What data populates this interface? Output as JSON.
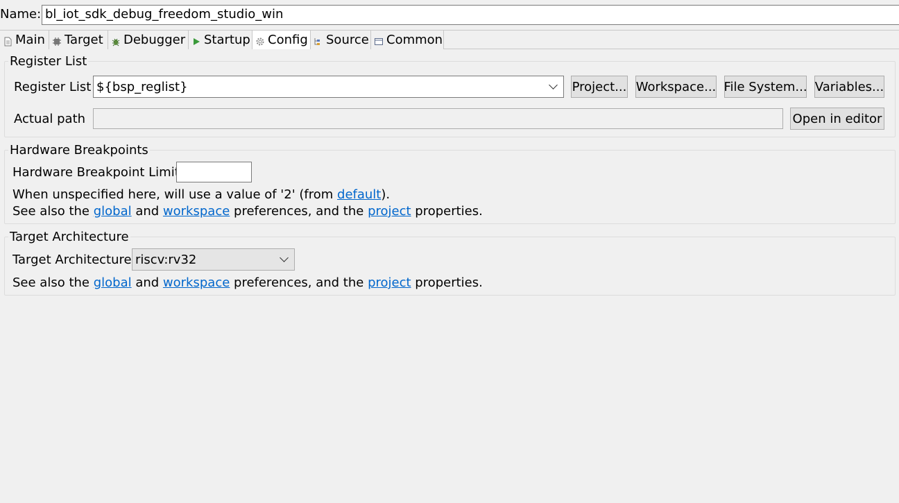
{
  "name": {
    "label": "Name:",
    "value": "bl_iot_sdk_debug_freedom_studio_win"
  },
  "tabs": [
    {
      "label": "Main",
      "icon": "document-icon"
    },
    {
      "label": "Target",
      "icon": "chip-icon"
    },
    {
      "label": "Debugger",
      "icon": "bug-icon"
    },
    {
      "label": "Startup",
      "icon": "play-icon"
    },
    {
      "label": "Config",
      "icon": "gear-icon"
    },
    {
      "label": "Source",
      "icon": "source-icon"
    },
    {
      "label": "Common",
      "icon": "window-icon"
    }
  ],
  "active_tab": "Config",
  "register_list": {
    "group_title": "Register List",
    "label": "Register List",
    "value": "${bsp_reglist}",
    "buttons": {
      "project": "Project...",
      "workspace": "Workspace...",
      "file_system": "File System...",
      "variables": "Variables..."
    },
    "actual_path_label": "Actual path",
    "actual_path_value": "",
    "open_editor": "Open in editor"
  },
  "hw_breakpoints": {
    "group_title": "Hardware Breakpoints",
    "label": "Hardware Breakpoint Limit",
    "value": "",
    "note_prefix": "When unspecified here, will use a value of '2' (from ",
    "note_link": "default",
    "note_suffix": ").",
    "see_also": {
      "prefix": "See also the ",
      "global": "global",
      "and": " and ",
      "workspace": "workspace",
      "mid": " preferences, and the ",
      "project": "project",
      "suffix": " properties."
    }
  },
  "target_arch": {
    "group_title": "Target Architecture",
    "label": "Target Architecture",
    "value": "riscv:rv32",
    "see_also": {
      "prefix": "See also the ",
      "global": "global",
      "and": " and ",
      "workspace": "workspace",
      "mid": " preferences, and the ",
      "project": "project",
      "suffix": " properties."
    }
  },
  "colors": {
    "link": "#0066cc",
    "background": "#f0f0f0"
  }
}
